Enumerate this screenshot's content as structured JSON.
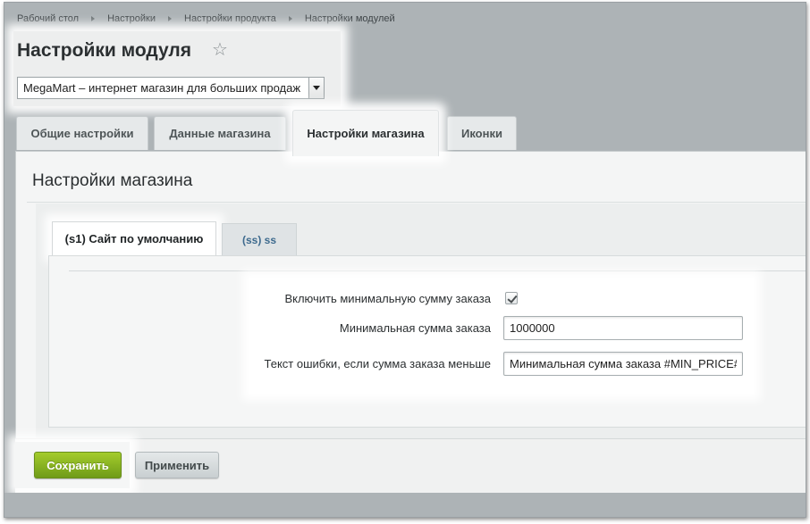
{
  "breadcrumb": [
    "Рабочий стол",
    "Настройки",
    "Настройки продукта",
    "Настройки модулей"
  ],
  "page_title": "Настройки модуля",
  "site_select": {
    "value": "MegaMart – интернет магазин для больших продаж"
  },
  "tabs": [
    {
      "label": "Общие настройки",
      "active": false
    },
    {
      "label": "Данные магазина",
      "active": false
    },
    {
      "label": "Настройки магазина",
      "active": true
    },
    {
      "label": "Иконки",
      "active": false
    }
  ],
  "panel_title": "Настройки магазина",
  "subtabs": [
    {
      "label": "(s1) Сайт по умолчанию",
      "active": true
    },
    {
      "label": "(ss) ss",
      "active": false
    }
  ],
  "form": {
    "min_order_enable_label": "Включить минимальную сумму заказа",
    "min_order_enabled": true,
    "min_order_sum_label": "Минимальная сумма заказа",
    "min_order_sum_value": "1000000",
    "error_text_label": "Текст ошибки, если сумма заказа меньше",
    "error_text_value": "Минимальная сумма заказа #MIN_PRICE# р"
  },
  "buttons": {
    "save": "Сохранить",
    "apply": "Применить"
  },
  "icons": {
    "favorite": "star-icon",
    "dropdown": "chevron-down-icon",
    "breadcrumb_separator": "chevron-right-icon",
    "checkbox": "checkmark-icon"
  },
  "colors": {
    "save_button": "#8db723",
    "link_tab": "#3d6a8e",
    "background": "#adb3b6"
  }
}
